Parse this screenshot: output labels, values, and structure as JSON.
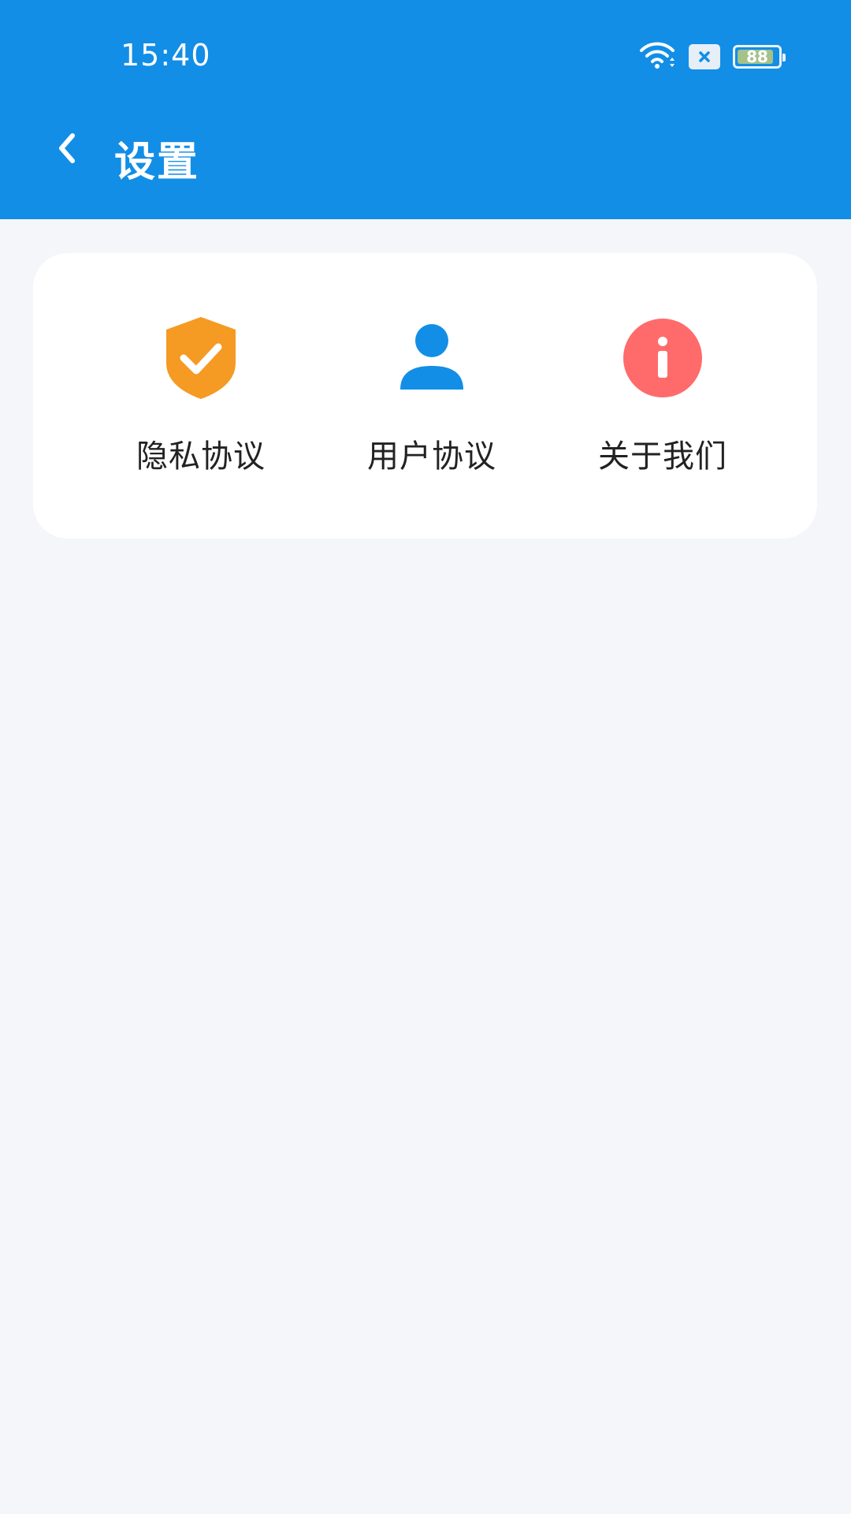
{
  "status_bar": {
    "time": "15:40",
    "battery": "88"
  },
  "app_bar": {
    "title": "设置"
  },
  "grid": {
    "items": [
      {
        "label": "隐私协议",
        "icon": "shield-check-icon",
        "color": "#F59A23"
      },
      {
        "label": "用户协议",
        "icon": "user-icon",
        "color": "#128EE6"
      },
      {
        "label": "关于我们",
        "icon": "info-icon",
        "color": "#FF6B6B"
      }
    ]
  },
  "colors": {
    "primary": "#128EE6",
    "background": "#F4F6F9"
  }
}
